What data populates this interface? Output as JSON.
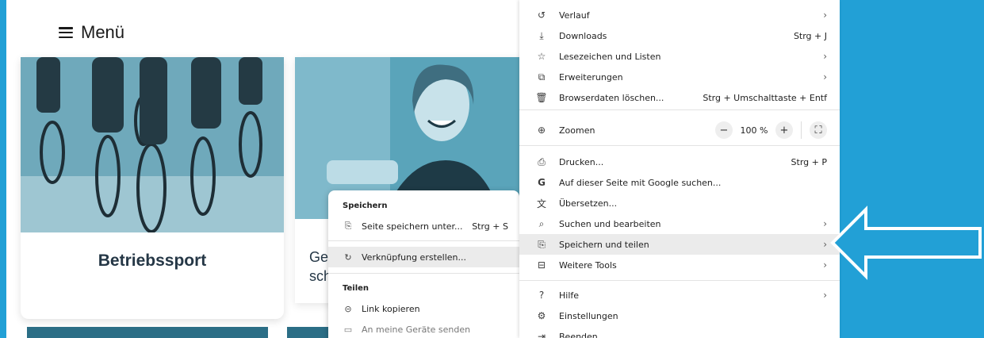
{
  "site": {
    "menu_label": "Menü",
    "card1_title": "Betriebssport",
    "card2_title": "Ges\nschu"
  },
  "submenu": {
    "section_save": "Speichern",
    "save_page_label": "Seite speichern unter...",
    "save_page_shortcut": "Strg + S",
    "create_shortcut_label": "Verknüpfung erstellen...",
    "section_share": "Teilen",
    "copy_link_label": "Link kopieren",
    "send_devices_label": "An meine Geräte senden"
  },
  "menu": {
    "history": "Verlauf",
    "downloads": "Downloads",
    "downloads_shortcut": "Strg + J",
    "bookmarks": "Lesezeichen und Listen",
    "extensions": "Erweiterungen",
    "clear_data": "Browserdaten löschen...",
    "clear_data_shortcut": "Strg + Umschalttaste + Entf",
    "zoom": "Zoomen",
    "zoom_minus": "−",
    "zoom_value": "100 %",
    "zoom_plus": "+",
    "print": "Drucken...",
    "print_shortcut": "Strg + P",
    "google_search": "Auf dieser Seite mit Google suchen...",
    "translate": "Übersetzen...",
    "find_edit": "Suchen und bearbeiten",
    "save_share": "Speichern und teilen",
    "more_tools": "Weitere Tools",
    "help": "Hilfe",
    "settings": "Einstellungen",
    "quit": "Beenden"
  },
  "colors": {
    "background": "#22a0d6",
    "highlight": "#ebebeb",
    "arrow": "#22a0d6"
  },
  "icons": {
    "history": "history-icon",
    "downloads": "download-icon",
    "bookmarks": "star-icon",
    "extensions": "puzzle-icon",
    "clear_data": "trash-icon",
    "zoom": "zoom-icon",
    "print": "printer-icon",
    "google": "google-icon",
    "translate": "translate-icon",
    "find_edit": "find-icon",
    "save_share": "save-share-icon",
    "more_tools": "toolbox-icon",
    "help": "help-icon",
    "settings": "gear-icon",
    "quit": "exit-icon"
  }
}
